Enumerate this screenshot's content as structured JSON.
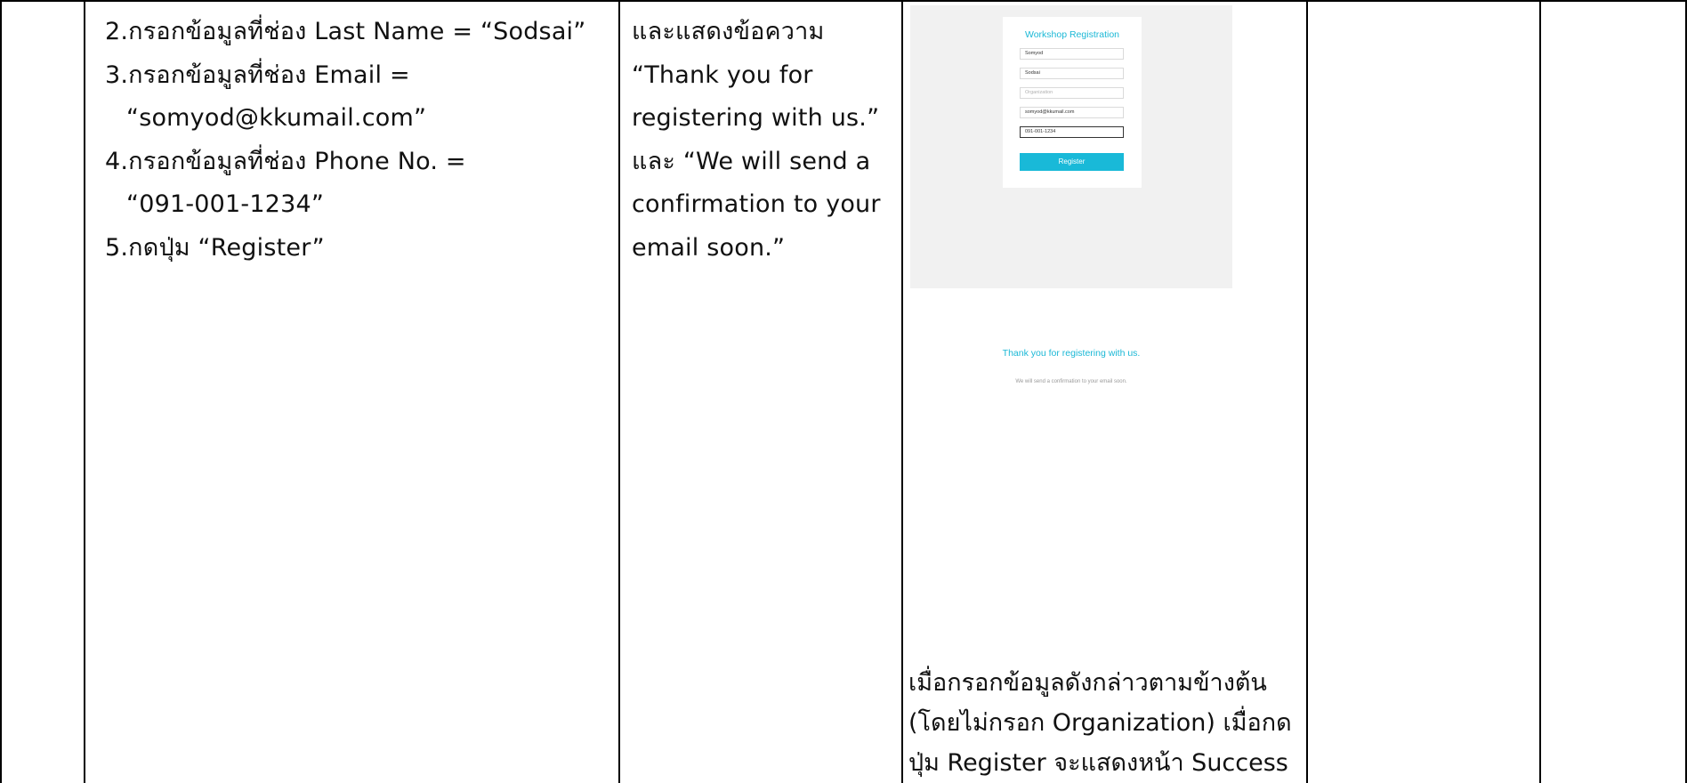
{
  "steps": [
    {
      "text": "2.กรอกข้อมูลที่ช่อง Last Name = “Sodsai”",
      "indent": false
    },
    {
      "text": "3.กรอกข้อมูลที่ช่อง Email =",
      "indent": false
    },
    {
      "text": "“somyod@kkumail.com”",
      "indent": true
    },
    {
      "text": "4.กรอกข้อมูลที่ช่อง Phone No. =",
      "indent": false
    },
    {
      "text": "“091-001-1234”",
      "indent": true
    },
    {
      "text": "5.กดปุ่ม “Register”",
      "indent": false
    }
  ],
  "expected": [
    "และแสดงข้อความ",
    "“Thank you for",
    "registering with us.”",
    "และ “We will send a",
    "confirmation to your",
    "email soon.”"
  ],
  "form_screenshot": {
    "title": "Workshop Registration",
    "fields": [
      {
        "value": "Somyod",
        "placeholder": false,
        "focused": false
      },
      {
        "value": "Sodsai",
        "placeholder": false,
        "focused": false
      },
      {
        "value": "Organization",
        "placeholder": true,
        "focused": false
      },
      {
        "value": "somyod@kkumail.com",
        "placeholder": false,
        "focused": false
      },
      {
        "value": "091-001-1234",
        "placeholder": false,
        "focused": true
      }
    ],
    "button": "Register",
    "accent_color": "#19b9d8"
  },
  "success_screenshot": {
    "title": "Thank you for registering with us.",
    "subtitle": "We will send a confirmation to your email soon."
  },
  "result_note": [
    "เมื่อกรอกข้อมูลดังกล่าวตามข้างต้น",
    "(โดยไม่กรอก Organization) เมื่อกด",
    "ปุ่ม Register จะแสดงหน้า Success"
  ]
}
